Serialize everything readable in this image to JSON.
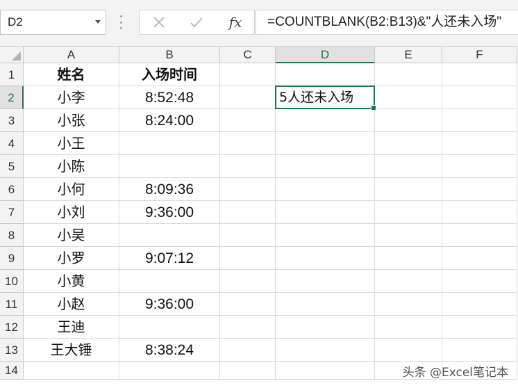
{
  "formula_bar": {
    "name_box": "D2",
    "cancel_icon": "close-icon",
    "enter_icon": "checkmark-icon",
    "fx_label": "fx",
    "formula": "=COUNTBLANK(B2:B13)&\"人还未入场\""
  },
  "grid": {
    "columns": [
      "A",
      "B",
      "C",
      "D",
      "E",
      "F"
    ],
    "selected_column": "D",
    "rows": [
      "1",
      "2",
      "3",
      "4",
      "5",
      "6",
      "7",
      "8",
      "9",
      "10",
      "11",
      "12",
      "13",
      "14"
    ],
    "selected_row": "2",
    "cells": {
      "A1": "姓名",
      "B1": "入场时间",
      "A2": "小李",
      "B2": "8:52:48",
      "D2": "5人还未入场",
      "A3": "小张",
      "B3": "8:24:00",
      "A4": "小王",
      "B4": "",
      "A5": "小陈",
      "B5": "",
      "A6": "小何",
      "B6": "8:09:36",
      "A7": "小刘",
      "B7": "9:36:00",
      "A8": "小吴",
      "B8": "",
      "A9": "小罗",
      "B9": "9:07:12",
      "A10": "小黄",
      "B10": "",
      "A11": "小赵",
      "B11": "9:36:00",
      "A12": "王迪",
      "B12": "",
      "A13": "王大锤",
      "B13": "8:38:24"
    }
  },
  "watermark": "头条 @Excel笔记本"
}
